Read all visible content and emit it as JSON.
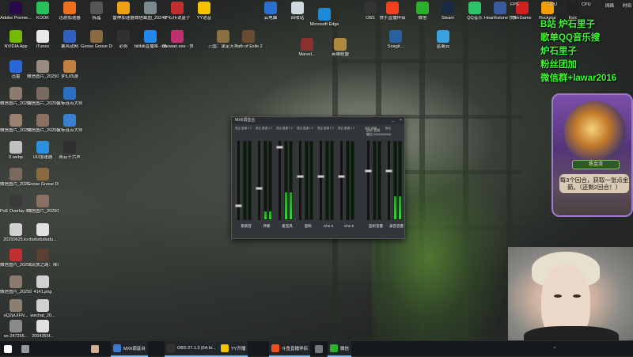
{
  "desktop_icons": [
    {
      "label": "Adobe Premie...",
      "color": "#2a0a4a",
      "icon": "premiere-icon"
    },
    {
      "label": "KOOK",
      "color": "#27c35a",
      "icon": "kook-icon"
    },
    {
      "label": "迅游加速器",
      "color": "#f07020",
      "icon": "xunyou-icon"
    },
    {
      "label": "拆晶",
      "color": "#555555",
      "icon": "app-icon"
    },
    {
      "label": "雷神加速器",
      "color": "#f0a010",
      "icon": "leishen-icon"
    },
    {
      "label": "微信截图_2024071...",
      "color": "#7a8a90",
      "icon": "image-icon"
    },
    {
      "label": "炉石传说盒子",
      "color": "#c03030",
      "icon": "hearthstone-box-icon"
    },
    {
      "label": "YY语音",
      "color": "#f5c400",
      "icon": "yy-icon"
    },
    {
      "label": "NVIDIA App",
      "color": "#76b900",
      "icon": "nvidia-icon"
    },
    {
      "label": "iTunes",
      "color": "#e8e8e8",
      "icon": "itunes-icon"
    },
    {
      "label": "暴风动网",
      "color": "#3060c0",
      "icon": "app-icon"
    },
    {
      "label": "Goose Goose Duck",
      "color": "#8a6a40",
      "icon": "goose-icon"
    },
    {
      "label": "必剪",
      "color": "#303030",
      "icon": "bijian-icon"
    },
    {
      "label": "bilibili直播姬 - 快捷方式",
      "color": "#2288ee",
      "icon": "bilibili-icon"
    },
    {
      "label": "xiaowan.exe - 快捷方式",
      "color": "#c03070",
      "icon": "xiaowan-icon"
    },
    {
      "label": "三国：谋定天下",
      "color": "#8a7040",
      "icon": "game-icon"
    },
    {
      "label": "Path of Exile 2",
      "color": "#6a4a30",
      "icon": "poe-icon"
    },
    {
      "label": "迅雷",
      "color": "#2a66d8",
      "icon": "xunlei-icon"
    },
    {
      "label": "微信图片_2025072...",
      "color": "#9a8a80",
      "icon": "image-icon"
    },
    {
      "label": "梦幻西游",
      "color": "#c08040",
      "icon": "game-icon"
    },
    {
      "label": "微信图片_2025072...",
      "color": "#8a7a70",
      "icon": "image-icon"
    },
    {
      "label": "微信图片_2025072...",
      "color": "#7a6a60",
      "icon": "image-icon"
    },
    {
      "label": "鼠标连点大师",
      "color": "#2a70c0",
      "icon": "mouse-icon"
    },
    {
      "label": "微信图片_2025072...",
      "color": "#9a8070",
      "icon": "image-icon"
    },
    {
      "label": "微信图片_2025072...",
      "color": "#8a7060",
      "icon": "image-icon"
    },
    {
      "label": "鼠标连点大师",
      "color": "#3a80d0",
      "icon": "mouse-icon"
    },
    {
      "label": "0.webp",
      "color": "#c0c0c0",
      "icon": "file-icon"
    },
    {
      "label": "UU加速器",
      "color": "#2a90e0",
      "icon": "uu-icon"
    },
    {
      "label": "燕云十六声",
      "color": "#303030",
      "icon": "game-icon"
    },
    {
      "label": "微信图片_2025...",
      "color": "#7a6a60",
      "icon": "image-icon"
    },
    {
      "label": "Goose Goose Duck",
      "color": "#8a6a40",
      "icon": "goose-icon"
    },
    {
      "label": "PoE Overlay II Standal...",
      "color": "#3a3a3a",
      "icon": "app-icon"
    },
    {
      "label": "微信图片_2025073...",
      "color": "#8a7060",
      "icon": "image-icon"
    },
    {
      "label": "20250625.kx",
      "color": "#d0d0d0",
      "icon": "file-icon"
    },
    {
      "label": "dududududu...",
      "color": "#e0e0e0",
      "icon": "file-icon"
    },
    {
      "label": "微信图片_2025062...",
      "color": "#c03030",
      "icon": "image-icon"
    },
    {
      "label": "《流放之路：降临》赛...",
      "color": "#5a4030",
      "icon": "game-icon"
    },
    {
      "label": "微信图片_2025091...",
      "color": "#8a7a70",
      "icon": "image-icon"
    },
    {
      "label": "4141.png",
      "color": "#d0d0d0",
      "icon": "image-icon"
    },
    {
      "label": "oQ2pUIFN...",
      "color": "#8a8070",
      "icon": "image-icon"
    },
    {
      "label": "wechat_20...",
      "color": "#d0d0d0",
      "icon": "file-icon"
    },
    {
      "label": "sn-247265...",
      "color": "#8a8a8a",
      "icon": "file-icon"
    },
    {
      "label": "2004355f...",
      "color": "#e0e0e0",
      "icon": "file-icon"
    },
    {
      "label": "云电脑",
      "color": "#2a70d0",
      "icon": "cloud-pc-icon"
    },
    {
      "label": "回收站",
      "color": "#cfd8dc",
      "icon": "recycle-bin-icon"
    },
    {
      "label": "Microsoft Edge",
      "color": "#1c8ad8",
      "icon": "edge-icon"
    },
    {
      "label": "英雄联盟",
      "color": "#b08a40",
      "icon": "game-icon"
    },
    {
      "label": "Marvel...",
      "color": "#8a3030",
      "icon": "game-icon"
    },
    {
      "label": "Snagit...",
      "color": "#2a60a0",
      "icon": "app-icon"
    },
    {
      "label": "蓝奏云",
      "color": "#3aa0e0",
      "icon": "app-icon"
    },
    {
      "label": "OBS",
      "color": "#333333",
      "icon": "obs-icon"
    },
    {
      "label": "快手直播伴侣",
      "color": "#f04020",
      "icon": "kuaishou-icon"
    },
    {
      "label": "微信",
      "color": "#2ab02a",
      "icon": "wechat-icon"
    },
    {
      "label": "Steam",
      "color": "#1a2a40",
      "icon": "steam-icon"
    },
    {
      "label": "QQ音乐",
      "color": "#2ec26a",
      "icon": "qqmusic-icon"
    },
    {
      "label": "Hearthstone 快捷方式",
      "color": "#3a5aa0",
      "icon": "hearthstone-icon"
    },
    {
      "label": "WeGame",
      "color": "#d02020",
      "icon": "wegame-icon"
    },
    {
      "label": "Rockstar",
      "color": "#f0a000",
      "icon": "app-icon"
    },
    {
      "label": "Epic",
      "color": "#222222",
      "icon": "app-icon"
    }
  ],
  "mixer": {
    "title": "MX6调音台",
    "min": "_",
    "close": "×",
    "readout_lines": [
      "返听 音频",
      "输出 0000000000"
    ],
    "channels": [
      {
        "name": "系统音",
        "fader": 0.18,
        "level": 0.0,
        "cfg": "混合 直通 1 2"
      },
      {
        "name": "伴奏",
        "fader": 0.4,
        "level": 0.1,
        "cfg": "混合 直通 1 2"
      },
      {
        "name": "麦克风",
        "fader": 0.92,
        "level": 0.35,
        "cfg": "混合 直通 1 2"
      },
      {
        "name": "混响",
        "fader": 0.55,
        "level": 0.0,
        "cfg": "混合 直通 1 2"
      },
      {
        "name": "Chn 5",
        "fader": 0.55,
        "level": 0.0,
        "cfg": "混合 直通 1 2"
      },
      {
        "name": "Chn 6",
        "fader": 0.55,
        "level": 0.0,
        "cfg": "混合 直通 1 2"
      },
      {
        "name": "监听音量",
        "fader": 0.62,
        "level": 0.0,
        "cfg": "返听 音频"
      },
      {
        "name": "录音音量",
        "fader": 0.62,
        "level": 0.3,
        "cfg": "输出"
      }
    ]
  },
  "overlay": {
    "lines": [
      "B站 炉石里子",
      "歌单QQ音乐搜",
      "炉石里子",
      "粉丝团加",
      "微信群+lawar2016"
    ]
  },
  "card": {
    "banner": "炼金流",
    "text": "每3个回合，获取一张点金箭。（还剩2回合！）"
  },
  "status": {
    "fps": "FPS",
    "gpu": "GPU",
    "cpu": "CPU",
    "net": "网络",
    "time": "时间"
  },
  "taskbar": {
    "items": [
      {
        "label": "",
        "color": "#ffffff",
        "icon": "windows-start-icon"
      },
      {
        "label": "",
        "color": "#999999",
        "icon": "search-icon"
      },
      {
        "label": "",
        "color": "#d0b090",
        "icon": "avatar-icon"
      },
      {
        "label": "MX6调音台",
        "color": "#3a7ad0",
        "icon": "mixer-icon",
        "active": true
      },
      {
        "label": "OBS 27.1.3 (64-bi...",
        "color": "#333333",
        "icon": "obs-icon",
        "active": true
      },
      {
        "label": "YY开播",
        "color": "#f5c400",
        "icon": "yy-icon",
        "active": true
      },
      {
        "label": "斗鱼直播伴侣",
        "color": "#f05020",
        "icon": "douyu-icon",
        "active": true
      },
      {
        "label": "",
        "color": "#777777",
        "icon": "app-icon"
      },
      {
        "label": "微信",
        "color": "#2ab02a",
        "icon": "wechat-icon",
        "active": true
      }
    ],
    "tray_text": "^"
  }
}
